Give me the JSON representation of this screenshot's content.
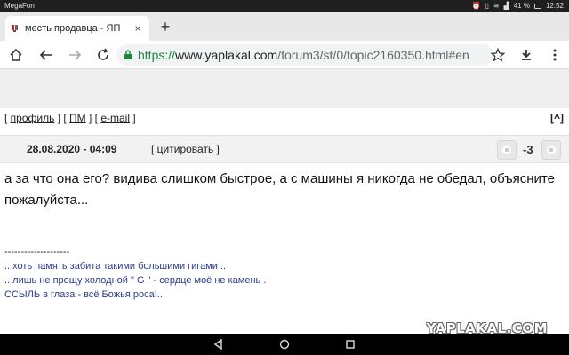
{
  "statusbar": {
    "carrier": "MegaFon",
    "battery": "41 %",
    "time": "12:52",
    "icons": [
      "alarm-icon",
      "vibrate-icon",
      "wifi-icon",
      "signal-icon",
      "battery-icon"
    ]
  },
  "tab": {
    "title": "месть продавца - ЯП",
    "favicon": "yaplakal-favicon",
    "close": "×",
    "new_tab": "+"
  },
  "toolbar": {
    "url_scheme": "https://",
    "url_host": "www.yaplakal.com",
    "url_path": "/forum3/st/0/topic2160350.html#en",
    "icons": [
      "home-icon",
      "back-icon",
      "forward-icon",
      "reload-icon",
      "lock-icon",
      "star-icon",
      "download-icon",
      "menu-icon"
    ]
  },
  "links_row": {
    "profile": "профиль",
    "pm": "ПМ",
    "email": "e-mail",
    "to_top": "[^]"
  },
  "post": {
    "date": "28.08.2020 - 04:09",
    "quote": "цитировать",
    "rating": "-3",
    "body": "а за что она его? видива слишком быстрое, а с машины я никогда не обедал, объясните пожалуйста...",
    "signature": {
      "separator": "--------------------",
      "line1": ".. хоть память забита такими большими гигами ..",
      "line2": ".. лишь не прощу холодной \" G \" - сердце моё не камень .",
      "line3": "ССЫЛЬ в глаза - всё Божья роса!.."
    }
  },
  "watermark": "YAPLAKAL.COM",
  "colors": {
    "url_scheme": "#1b8a3a",
    "signature": "#2b3c8c",
    "post_header_bg": "#f2f2f2"
  }
}
